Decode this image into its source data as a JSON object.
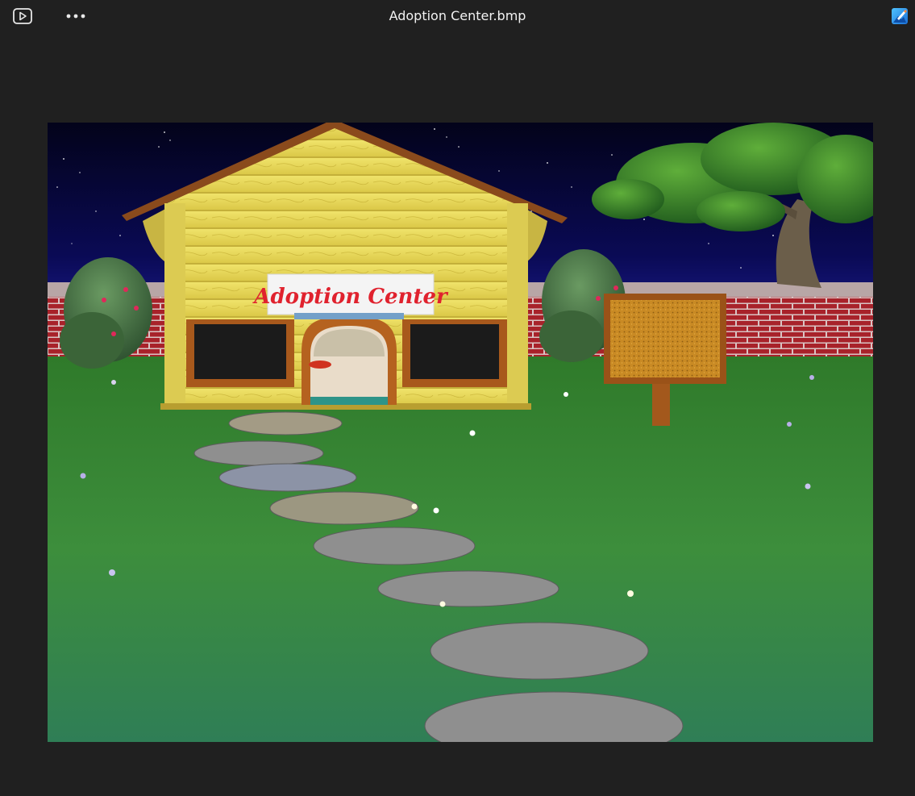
{
  "window": {
    "title": "Adoption Center.bmp"
  },
  "toolbar": {
    "slideshow_icon": "slideshow-icon",
    "more_icon": "more-icon",
    "editor_icon": "photo-editor-icon"
  },
  "image": {
    "sign_text": "Adoption Center"
  },
  "colors": {
    "background": "#202020",
    "title_text": "#f2f2f2",
    "accent": "#2b9be8"
  }
}
